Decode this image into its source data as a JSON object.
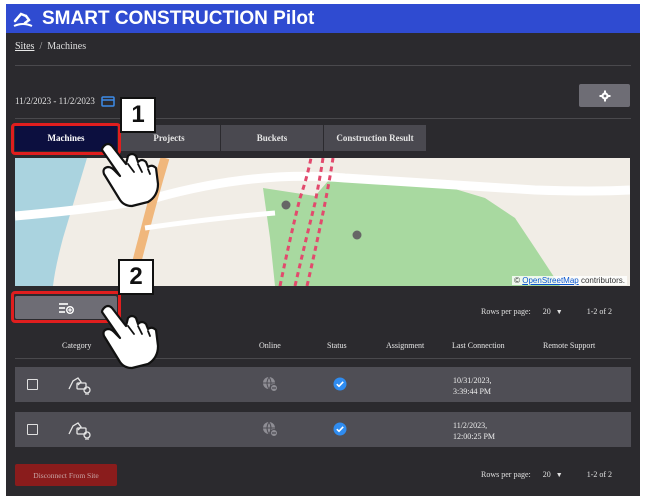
{
  "app": {
    "title": "SMART CONSTRUCTION Pilot",
    "logo_icon": "excavator-arm-logo-icon"
  },
  "breadcrumb": {
    "sites": "Sites",
    "separator": "/",
    "current": "Machines"
  },
  "date_range": {
    "text": "11/2/2023 - 11/2/2023",
    "icon": "calendar-icon"
  },
  "settings_button": {
    "icon": "gear-icon"
  },
  "tabs": [
    {
      "label": "Machines",
      "active": true
    },
    {
      "label": "Projects",
      "active": false
    },
    {
      "label": "Buckets",
      "active": false
    },
    {
      "label": "Construction Result",
      "active": false
    }
  ],
  "map": {
    "attribution_prefix": "©",
    "attribution_link": "OpenStreetMap",
    "attribution_suffix": "contributors."
  },
  "filter_button": {
    "icon": "add-filter-icon"
  },
  "pagination_top": {
    "rows_per_page_label": "Rows per page:",
    "rows_per_page_value": "20",
    "range": "1-2 of 2"
  },
  "table": {
    "columns": [
      "Category",
      "Online",
      "Status",
      "Assignment",
      "Last Connection",
      "Remote Support"
    ],
    "rows": [
      {
        "category_icon": "excavator-icon",
        "online_icon": "offline-globe-icon",
        "status_icon": "check-circle-icon",
        "assignment": "",
        "last_connection_date": "10/31/2023,",
        "last_connection_time": "3:39:44 PM",
        "remote_support": ""
      },
      {
        "category_icon": "excavator-icon",
        "online_icon": "offline-globe-icon",
        "status_icon": "check-circle-icon",
        "assignment": "",
        "last_connection_date": "11/2/2023,",
        "last_connection_time": "12:00:25 PM",
        "remote_support": ""
      }
    ]
  },
  "pagination_bottom": {
    "rows_per_page_label": "Rows per page:",
    "rows_per_page_value": "20",
    "range": "1-2 of 2"
  },
  "disconnect_button": {
    "label": "Disconnect From Site"
  },
  "callouts": [
    {
      "number": "1",
      "target": "Machines tab"
    },
    {
      "number": "2",
      "target": "filter button"
    }
  ],
  "colors": {
    "title_bar": "#2f4bd1",
    "background": "#2b2a2e",
    "active_tab": "#0c0f3f",
    "callout_red": "#e01e1e",
    "status_blue": "#2f8cf0",
    "disconnect_red": "#8a1c1c"
  }
}
